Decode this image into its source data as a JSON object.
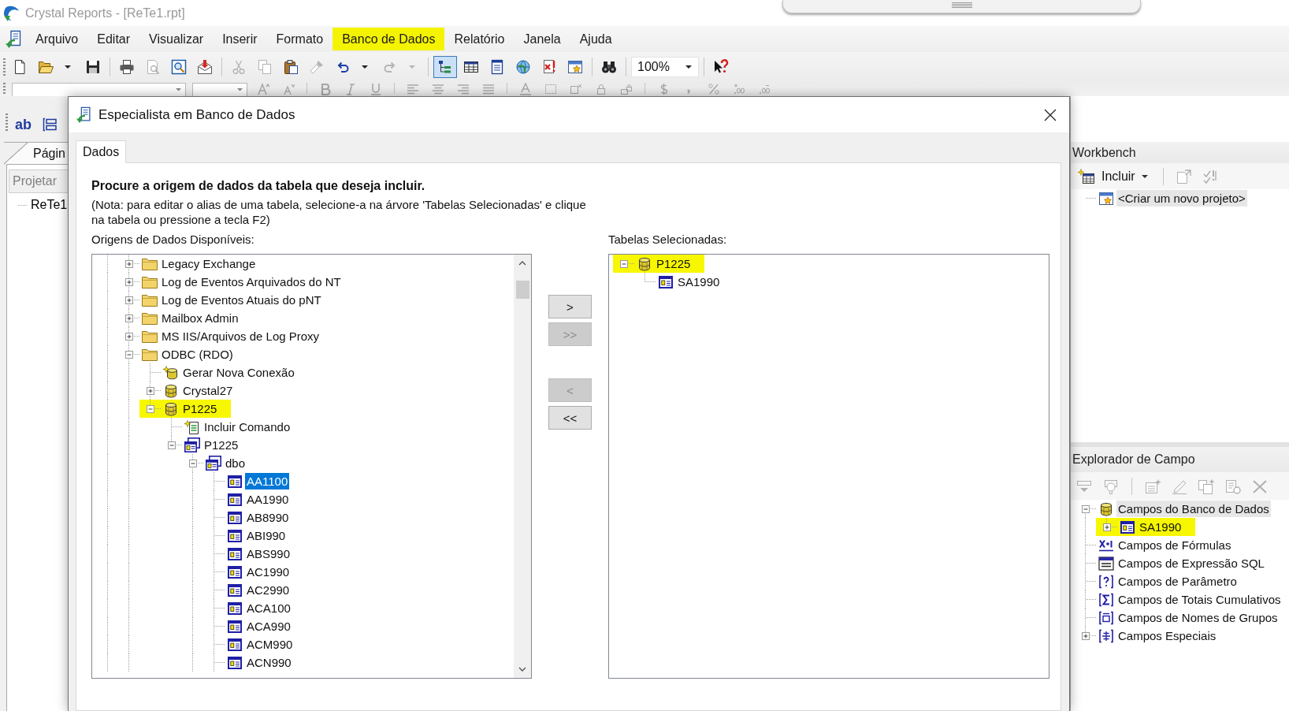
{
  "window": {
    "title": "Crystal Reports - [ReTe1.rpt]"
  },
  "menu": [
    {
      "label": "Arquivo",
      "highlighted": false
    },
    {
      "label": "Editar",
      "highlighted": false
    },
    {
      "label": "Visualizar",
      "highlighted": false
    },
    {
      "label": "Inserir",
      "highlighted": false
    },
    {
      "label": "Formato",
      "highlighted": false
    },
    {
      "label": "Banco de Dados",
      "highlighted": true
    },
    {
      "label": "Relatório",
      "highlighted": false
    },
    {
      "label": "Janela",
      "highlighted": false
    },
    {
      "label": "Ajuda",
      "highlighted": false
    }
  ],
  "toolbar": [
    {
      "kind": "new",
      "disabled": false,
      "pressed": false
    },
    {
      "kind": "open",
      "disabled": false,
      "pressed": false,
      "dropdown": true
    },
    {
      "kind": "save",
      "disabled": false,
      "pressed": false
    },
    {
      "kind": "separator"
    },
    {
      "kind": "print",
      "disabled": false,
      "pressed": false
    },
    {
      "kind": "print-preview",
      "disabled": true,
      "pressed": false
    },
    {
      "kind": "preview",
      "disabled": false,
      "pressed": false
    },
    {
      "kind": "export",
      "disabled": false,
      "pressed": false
    },
    {
      "kind": "separator"
    },
    {
      "kind": "cut",
      "disabled": true,
      "pressed": false
    },
    {
      "kind": "copy",
      "disabled": true,
      "pressed": false
    },
    {
      "kind": "paste",
      "disabled": false,
      "pressed": false
    },
    {
      "kind": "format-painter",
      "disabled": true,
      "pressed": false
    },
    {
      "kind": "undo",
      "disabled": false,
      "pressed": false,
      "dropdown": true
    },
    {
      "kind": "redo",
      "disabled": true,
      "pressed": false,
      "dropdown": true
    },
    {
      "kind": "separator"
    },
    {
      "kind": "field-tree",
      "disabled": false,
      "pressed": true
    },
    {
      "kind": "table",
      "disabled": false,
      "pressed": false
    },
    {
      "kind": "page",
      "disabled": false,
      "pressed": false
    },
    {
      "kind": "web",
      "disabled": false,
      "pressed": false
    },
    {
      "kind": "error",
      "disabled": false,
      "pressed": false
    },
    {
      "kind": "star-window",
      "disabled": false,
      "pressed": false
    },
    {
      "kind": "separator"
    },
    {
      "kind": "find",
      "disabled": false,
      "pressed": false
    },
    {
      "kind": "separator"
    },
    {
      "kind": "zoom",
      "value": "100%"
    },
    {
      "kind": "separator"
    },
    {
      "kind": "help",
      "disabled": false,
      "pressed": false
    }
  ],
  "format_toolbar": [
    {
      "kind": "font-field"
    },
    {
      "kind": "size-field"
    },
    {
      "kind": "grow-font",
      "disabled": true
    },
    {
      "kind": "shrink-font",
      "disabled": true
    },
    {
      "kind": "separator"
    },
    {
      "kind": "bold",
      "disabled": true
    },
    {
      "kind": "italic",
      "disabled": true
    },
    {
      "kind": "underline",
      "disabled": true
    },
    {
      "kind": "separator"
    },
    {
      "kind": "align-left",
      "disabled": true
    },
    {
      "kind": "align-center",
      "disabled": true
    },
    {
      "kind": "align-right",
      "disabled": true
    },
    {
      "kind": "align-justify",
      "disabled": true
    },
    {
      "kind": "separator"
    },
    {
      "kind": "font-color",
      "disabled": true
    },
    {
      "kind": "border",
      "disabled": true
    },
    {
      "kind": "frame",
      "disabled": true
    },
    {
      "kind": "lock-size",
      "disabled": true
    },
    {
      "kind": "lock-position",
      "disabled": true
    },
    {
      "kind": "separator"
    },
    {
      "kind": "currency",
      "disabled": true
    },
    {
      "kind": "thousands",
      "disabled": true
    },
    {
      "kind": "percent",
      "disabled": true
    },
    {
      "kind": "add-decimal",
      "disabled": true
    },
    {
      "kind": "remove-decimal",
      "disabled": true
    }
  ],
  "left_panel": {
    "tools": [
      {
        "kind": "text-object",
        "label": "ab"
      },
      {
        "kind": "box"
      }
    ],
    "page_tab": "Págin",
    "design_tab": "Projetar",
    "tree_item": "ReTe1"
  },
  "dialog": {
    "title": "Especialista em Banco de Dados",
    "tabs": [
      {
        "label": "Dados",
        "selected": true
      }
    ],
    "heading": "Procure a origem de dados da tabela que deseja incluir.",
    "note": "(Nota: para editar o alias de uma tabela, selecione-a na árvore 'Tabelas Selecionadas' e clique na tabela ou pressione a tecla F2)",
    "sources_label": "Origens de Dados Disponíveis:",
    "sources": [
      {
        "label": "Legacy Exchange",
        "kind": "folder",
        "expanded": false
      },
      {
        "label": "Log de Eventos Arquivados do NT",
        "kind": "folder",
        "expanded": false
      },
      {
        "label": "Log de Eventos Atuais do pNT",
        "kind": "folder",
        "expanded": false
      },
      {
        "label": "Mailbox Admin",
        "kind": "folder",
        "expanded": false
      },
      {
        "label": "MS IIS/Arquivos de Log Proxy",
        "kind": "folder",
        "expanded": false
      },
      {
        "label": "ODBC (RDO)",
        "kind": "folder",
        "expanded": true,
        "continues": true,
        "children": [
          {
            "label": "Gerar Nova Conexão",
            "kind": "new-connection",
            "highlighted": false
          },
          {
            "label": "Crystal27",
            "kind": "database",
            "expanded": false,
            "highlighted": false
          },
          {
            "label": "P1225",
            "kind": "database",
            "expanded": true,
            "highlighted": true,
            "children": [
              {
                "label": "Incluir Comando",
                "kind": "command"
              },
              {
                "label": "P1225",
                "kind": "schema",
                "expanded": true,
                "children": [
                  {
                    "label": "dbo",
                    "kind": "schema",
                    "expanded": true,
                    "continues": true,
                    "children": [
                      {
                        "label": "AA1100",
                        "kind": "table",
                        "selected": true
                      },
                      {
                        "label": "AA1990",
                        "kind": "table",
                        "selected": false
                      },
                      {
                        "label": "AB8990",
                        "kind": "table",
                        "selected": false
                      },
                      {
                        "label": "ABI990",
                        "kind": "table",
                        "selected": false
                      },
                      {
                        "label": "ABS990",
                        "kind": "table",
                        "selected": false
                      },
                      {
                        "label": "AC1990",
                        "kind": "table",
                        "selected": false
                      },
                      {
                        "label": "AC2990",
                        "kind": "table",
                        "selected": false
                      },
                      {
                        "label": "ACA100",
                        "kind": "table",
                        "selected": false
                      },
                      {
                        "label": "ACA990",
                        "kind": "table",
                        "selected": false
                      },
                      {
                        "label": "ACM990",
                        "kind": "table",
                        "selected": false
                      },
                      {
                        "label": "ACN990",
                        "kind": "table",
                        "selected": false,
                        "continues": true
                      }
                    ]
                  }
                ]
              }
            ]
          }
        ]
      }
    ],
    "buttons": [
      {
        "label": ">",
        "disabled": false
      },
      {
        "label": ">>",
        "disabled": true
      },
      {
        "label": "<",
        "disabled": true
      },
      {
        "label": "<<",
        "disabled": false
      }
    ],
    "selected_label": "Tabelas Selecionadas:",
    "selected_tables": [
      {
        "label": "P1225",
        "kind": "database",
        "expanded": true,
        "highlighted": true,
        "children": [
          {
            "label": "SA1990",
            "kind": "table",
            "highlighted": false
          }
        ]
      }
    ]
  },
  "workbench": {
    "title": "Workbench",
    "toolbar": [
      {
        "kind": "add",
        "label": "Incluir",
        "disabled": false,
        "dropdown": true
      },
      {
        "kind": "separator"
      },
      {
        "kind": "export-project",
        "disabled": true
      },
      {
        "kind": "check",
        "disabled": true
      }
    ],
    "items": [
      {
        "label": "<Criar um novo projeto>",
        "kind": "new-project",
        "selected": true
      }
    ]
  },
  "field_explorer": {
    "title": "Explorador de Campo",
    "toolbar": [
      {
        "kind": "insert",
        "disabled": true
      },
      {
        "kind": "browse",
        "disabled": true
      },
      {
        "kind": "separator"
      },
      {
        "kind": "new",
        "disabled": true
      },
      {
        "kind": "edit",
        "disabled": true
      },
      {
        "kind": "duplicate",
        "disabled": true
      },
      {
        "kind": "rename",
        "disabled": true
      },
      {
        "kind": "delete",
        "disabled": true
      }
    ],
    "items": [
      {
        "label": "Campos do Banco de Dados",
        "kind": "database",
        "expanded": true,
        "selected": true,
        "children": [
          {
            "label": "SA1990",
            "kind": "table",
            "expanded": false,
            "selected": false,
            "highlighted": true
          }
        ]
      },
      {
        "label": "Campos de Fórmulas",
        "kind": "formula",
        "selected": false
      },
      {
        "label": "Campos de Expressão SQL",
        "kind": "sql",
        "selected": false
      },
      {
        "label": "Campos de Parâmetro",
        "kind": "parameter",
        "selected": false
      },
      {
        "label": "Campos de Totais Cumulativos",
        "kind": "sigma",
        "selected": false
      },
      {
        "label": "Campos de Nomes de Grupos",
        "kind": "group-name",
        "selected": false
      },
      {
        "label": "Campos Especiais",
        "kind": "special",
        "expanded": false,
        "selected": false
      }
    ]
  }
}
